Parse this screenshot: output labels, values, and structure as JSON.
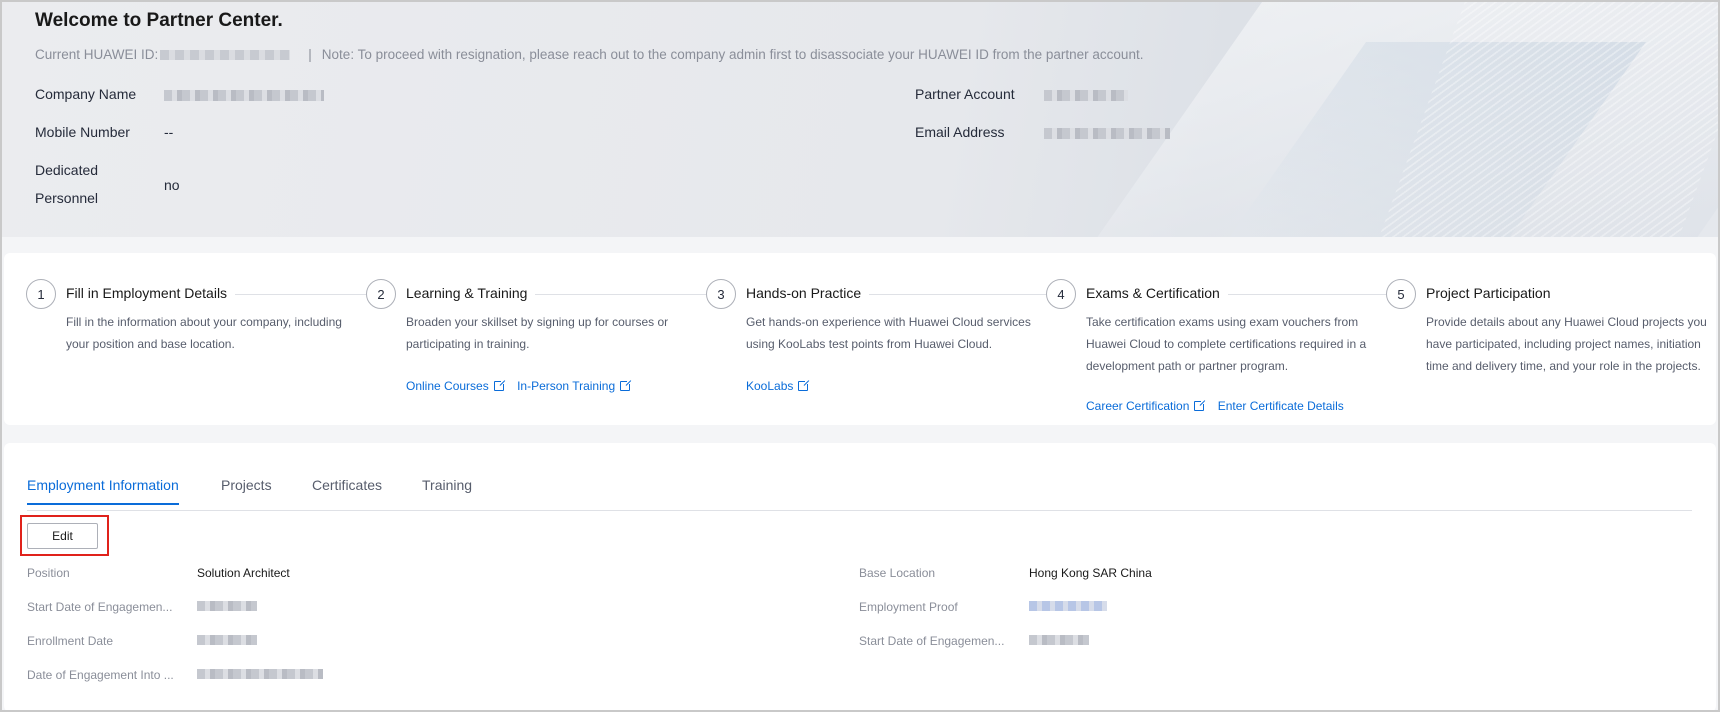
{
  "header": {
    "title": "Welcome to Partner Center.",
    "id_prefix": "Current HUAWEI ID:",
    "separator": "|",
    "note": "Note: To proceed with resignation, please reach out to the company admin first to disassociate your HUAWEI ID from the partner account."
  },
  "profile": {
    "company_name_label": "Company Name",
    "mobile_label": "Mobile Number",
    "mobile_value": "--",
    "dedicated_label_line1": "Dedicated",
    "dedicated_label_line2": "Personnel",
    "dedicated_value": "no",
    "partner_account_label": "Partner Account",
    "email_label": "Email Address"
  },
  "steps": [
    {
      "num": "1",
      "title": "Fill in Employment Details",
      "desc_lines": [
        "Fill in the information about your company, including",
        "your position and base location."
      ],
      "links": []
    },
    {
      "num": "2",
      "title": "Learning & Training",
      "desc_lines": [
        "Broaden your skillset by signing up for courses or",
        "participating in training."
      ],
      "links": [
        "Online Courses",
        "In-Person Training"
      ]
    },
    {
      "num": "3",
      "title": "Hands-on Practice",
      "desc_lines": [
        "Get hands-on experience with Huawei Cloud services",
        "using KooLabs test points from Huawei Cloud."
      ],
      "links": [
        "KooLabs"
      ]
    },
    {
      "num": "4",
      "title": "Exams & Certification",
      "desc_lines": [
        "Take certification exams using exam vouchers from",
        "Huawei Cloud to complete certifications required in a",
        "development path or partner program."
      ],
      "links": [
        "Career Certification",
        "Enter Certificate Details"
      ]
    },
    {
      "num": "5",
      "title": "Project Participation",
      "desc_lines": [
        "Provide details about any Huawei Cloud projects you",
        "have participated, including project names, initiation",
        "time and delivery time, and your role in the projects."
      ],
      "links": []
    }
  ],
  "tabs": [
    "Employment Information",
    "Projects",
    "Certificates",
    "Training"
  ],
  "active_tab": "Employment Information",
  "edit_label": "Edit",
  "employment": {
    "position_label": "Position",
    "position_value": "Solution Architect",
    "start_date_label": "Start Date of Engagemen...",
    "enrollment_label": "Enrollment Date",
    "engagement_into_label": "Date of Engagement Into ...",
    "base_location_label": "Base Location",
    "base_location_value": "Hong Kong SAR China",
    "employment_proof_label": "Employment Proof",
    "start_date_right_label": "Start Date of Engagemen..."
  },
  "colors": {
    "accent": "#0a6cd9",
    "highlight_box": "#e0221b"
  }
}
